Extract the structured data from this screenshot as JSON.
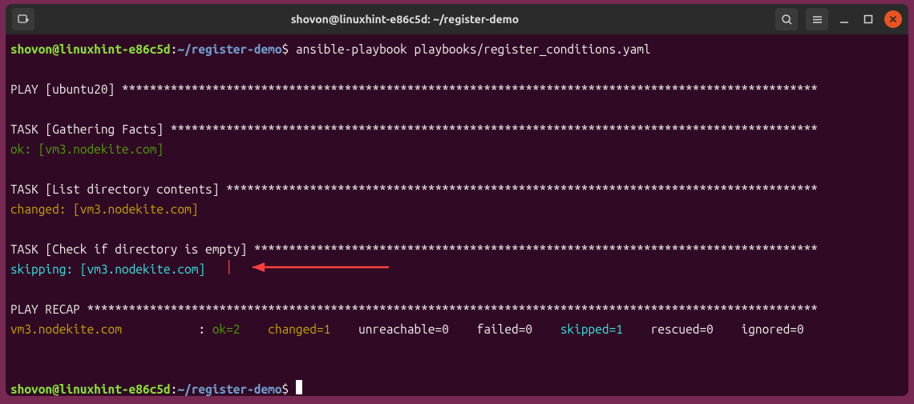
{
  "titlebar": {
    "title": "shovon@linuxhint-e86c5d: ~/register-demo"
  },
  "prompt": {
    "user_host": "shovon@linuxhint-e86c5d",
    "colon": ":",
    "path": "~/register-demo",
    "dollar": "$"
  },
  "command": "ansible-playbook playbooks/register_conditions.yaml",
  "play_header": "PLAY [ubuntu20] ****************************************************************************************************",
  "task1_header": "TASK [Gathering Facts] *********************************************************************************************",
  "task1_result_prefix": "ok: ",
  "task1_result_host": "[vm3.nodekite.com]",
  "task2_header": "TASK [List directory contents] *************************************************************************************",
  "task2_result_prefix": "changed: ",
  "task2_result_host": "[vm3.nodekite.com]",
  "task3_header": "TASK [Check if directory is empty] *********************************************************************************",
  "task3_result_prefix": "skipping: ",
  "task3_result_host": "[vm3.nodekite.com]",
  "recap_header": "PLAY RECAP *********************************************************************************************************",
  "recap": {
    "host": "vm3.nodekite.com",
    "spacer": "           : ",
    "ok": "ok=2",
    "sep1": "    ",
    "changed": "changed=1",
    "sep2": "    ",
    "unreachable": "unreachable=0",
    "sep3": "    ",
    "failed": "failed=0",
    "sep4": "    ",
    "skipped": "skipped=1",
    "sep5": "    ",
    "rescued": "rescued=0",
    "sep6": "    ",
    "ignored": "ignored=0"
  }
}
